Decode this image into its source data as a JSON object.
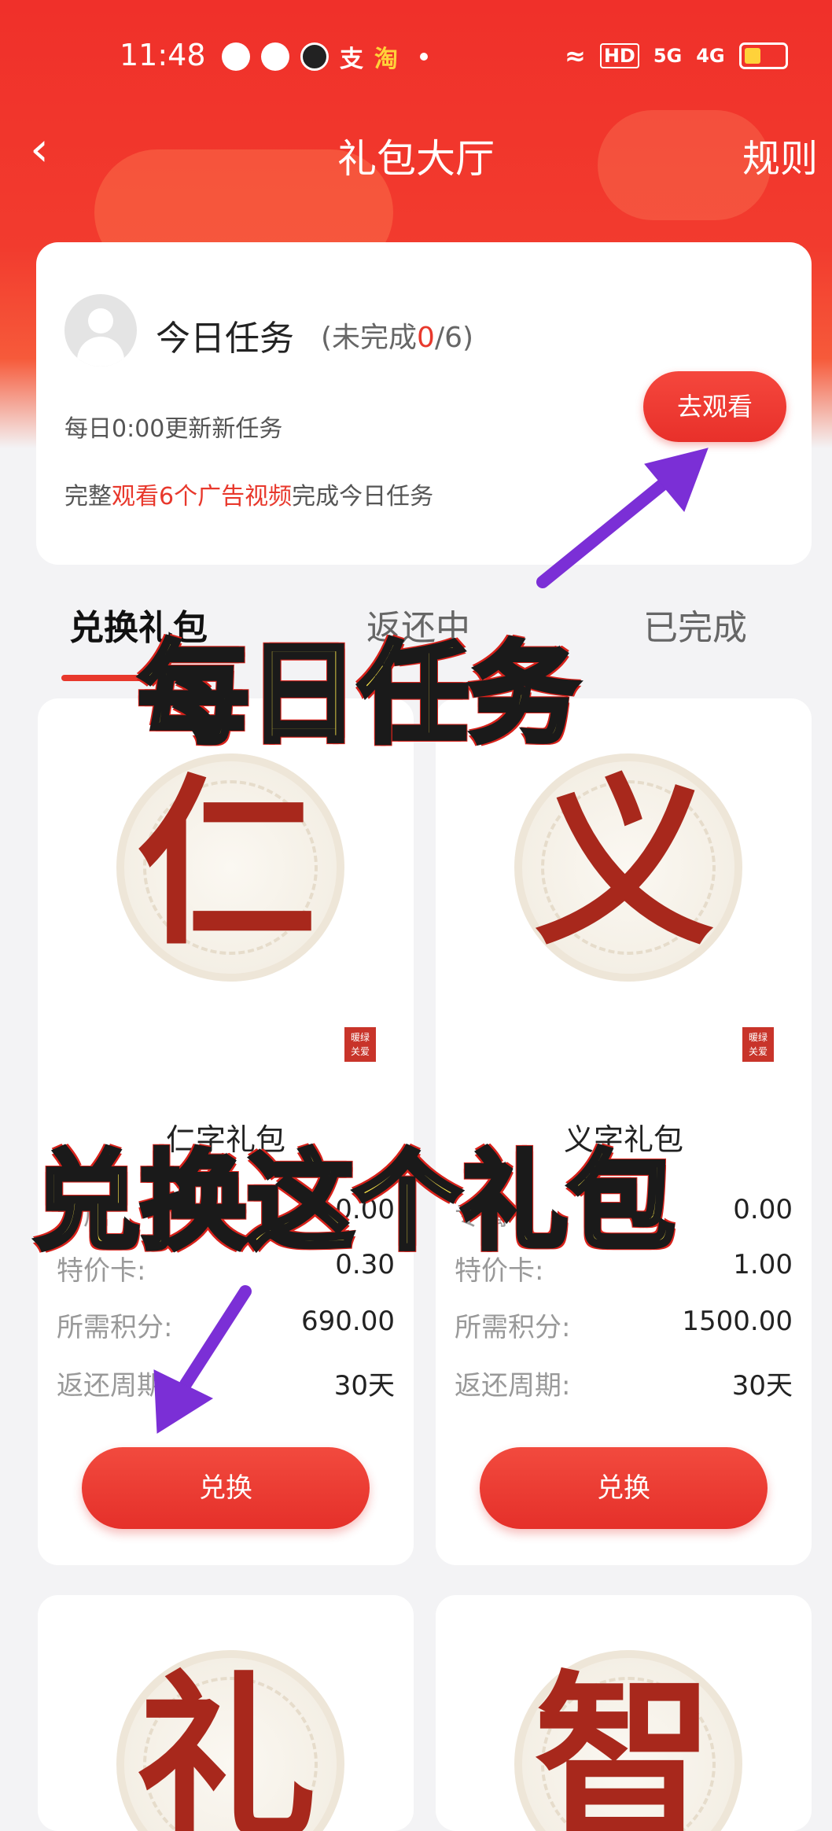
{
  "status_bar": {
    "time": "11:48",
    "app_labels": [
      "支",
      "淘"
    ],
    "network": [
      "HD",
      "5G",
      "4G"
    ]
  },
  "nav": {
    "title": "礼包大厅",
    "rules": "规则"
  },
  "task": {
    "title": "今日任务",
    "progress_open": "(未完成",
    "progress_done": "0",
    "progress_total": "/6)",
    "refresh_note": "每日0:00更新新任务",
    "desc_pre": "完整",
    "desc_highlight": "观看6个广告视频",
    "desc_post": "完成今日任务",
    "watch_button": "去观看"
  },
  "tabs": [
    {
      "label": "兑换礼包"
    },
    {
      "label": "返还中"
    },
    {
      "label": "已完成"
    }
  ],
  "gifts": [
    {
      "glyph": "仁",
      "seal": "暖绿关爱",
      "name": "仁字礼包",
      "rows": [
        {
          "label": "专属",
          "value": "0.00"
        },
        {
          "label": "特价卡:",
          "value": "0.30"
        },
        {
          "label": "所需积分:",
          "value": "690.00"
        },
        {
          "label": "返还周期:",
          "value": "30天"
        }
      ],
      "button": "兑换"
    },
    {
      "glyph": "义",
      "seal": "暖绿关爱",
      "name": "义字礼包",
      "rows": [
        {
          "label": "专属",
          "value": "0.00"
        },
        {
          "label": "特价卡:",
          "value": "1.00"
        },
        {
          "label": "所需积分:",
          "value": "1500.00"
        },
        {
          "label": "返还周期:",
          "value": "30天"
        }
      ],
      "button": "兑换"
    },
    {
      "glyph": "礼"
    },
    {
      "glyph": "智"
    }
  ],
  "overlays": {
    "daily_task": "每日任务",
    "redeem_this": "兑换这个礼包"
  },
  "colors": {
    "accent": "#e8382c",
    "overlay_text": "#ffe94a",
    "arrow": "#7b2fd6"
  }
}
